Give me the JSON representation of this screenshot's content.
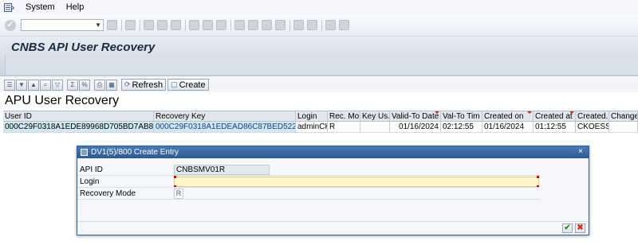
{
  "menu": {
    "items": [
      "System",
      "Help"
    ]
  },
  "title": "CNBS API User Recovery",
  "toolbar": {
    "refresh_label": "Refresh",
    "create_label": "Create"
  },
  "grid": {
    "title": "APU User Recovery",
    "headers": [
      "User ID",
      "Recovery Key",
      "Login",
      "Rec. Mo..",
      "Key Us..",
      "Valid-To Date",
      "Val-To Tim",
      "Created on",
      "Created at",
      "Created..",
      "Changed"
    ],
    "rows": [
      [
        "000C29F0318A1EDE89968D705BD7AB81",
        "000C29F0318A1EDEAD86C87BED522B81",
        "adminCK",
        "R",
        "",
        "01/16/2024",
        "02:12:55",
        "01/16/2024",
        "01:12:55",
        "CKOESSL",
        ""
      ]
    ]
  },
  "dialog": {
    "title": "DV1(5)/800 Create Entry",
    "close_symbol": "×",
    "fields": {
      "api_id_label": "API ID",
      "api_id_value": "CNBSMV01R",
      "login_label": "Login",
      "login_value": "",
      "recovery_mode_label": "Recovery Mode",
      "recovery_mode_value": "R"
    },
    "confirm_symbol": "✔",
    "cancel_symbol": "✖"
  },
  "colors": {
    "title_text": "#1d2b3b",
    "dialog_header": "#2c5a94",
    "key_cell": "#cfe8f2",
    "input_required": "#fff7c9",
    "confirm": "#2e8b2e",
    "cancel": "#d32f2f"
  },
  "icons": {
    "menu_sys": "sap-menu-icon",
    "ok": "enter-icon",
    "refresh": "refresh-icon",
    "create": "create-icon"
  }
}
